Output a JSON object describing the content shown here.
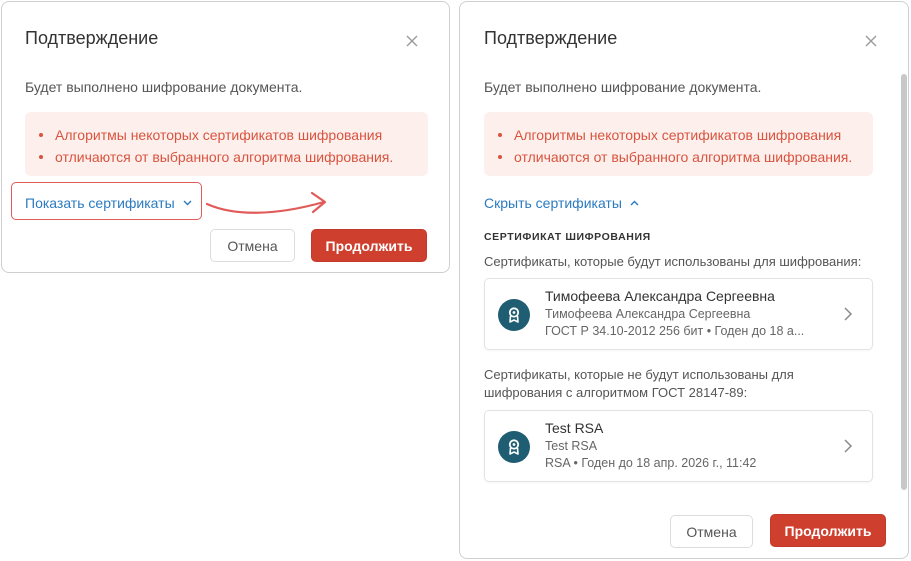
{
  "dialog_collapsed": {
    "title": "Подтверждение",
    "description": "Будет выполнено шифрование документа.",
    "alert_lines": [
      "Алгоритмы некоторых сертификатов шифрования",
      "отличаются от выбранного алгоритма шифрования."
    ],
    "toggle_label": "Показать сертификаты",
    "toggle_chevron": "⌄",
    "cancel_label": "Отмена",
    "continue_label": "Продолжить"
  },
  "dialog_expanded": {
    "title": "Подтверждение",
    "description": "Будет выполнено шифрование документа.",
    "alert_lines": [
      "Алгоритмы некоторых сертификатов шифрования",
      "отличаются от выбранного алгоритма шифрования."
    ],
    "toggle_label": "Скрыть сертификаты",
    "toggle_chevron": "⌃",
    "section_heading": "СЕРТИФИКАТ ШИФРОВАНИЯ",
    "used_caption": "Сертификаты, которые будут использованы для шифрования:",
    "unused_caption_lines": [
      "Сертификаты, которые не будут использованы для",
      "шифрования с алгоритмом ГОСТ 28147-89:"
    ],
    "certificates": [
      {
        "name": "Тимофеева Александра Сергеевна",
        "subject": "Тимофеева Александра Сергеевна",
        "details": "ГОСТ Р 34.10-2012 256 бит • Годен до 18 а..."
      },
      {
        "name": "Test RSA",
        "subject": "Test RSA",
        "details": "RSA • Годен до 18 апр. 2026 г., 11:42"
      }
    ],
    "cancel_label": "Отмена",
    "continue_label": "Продолжить"
  },
  "icons": {
    "close": "close-icon",
    "certificate": "certificate-icon",
    "chevron_right": "chevron-right-icon",
    "annotation_arrow": "arrow-right-icon"
  },
  "colors": {
    "accent_red": "#cf3f2e",
    "alert_bg": "#fdf0ec",
    "alert_text": "#d9533f",
    "link_blue": "#2b7bc0",
    "avatar_teal": "#1f5d72",
    "annotation": "#e05b59"
  }
}
